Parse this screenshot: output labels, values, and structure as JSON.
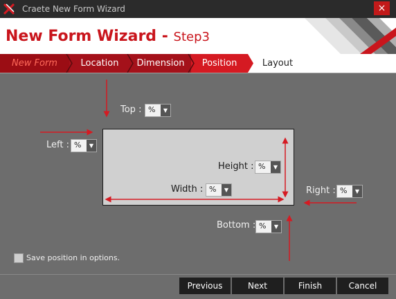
{
  "window": {
    "title": "Craete New Form Wizard",
    "close_glyph": "×"
  },
  "header": {
    "title": "New Form Wizard - ",
    "step": "Step3"
  },
  "tabs": [
    {
      "label": "New Form"
    },
    {
      "label": "Location"
    },
    {
      "label": "Dimension"
    },
    {
      "label": "Position"
    },
    {
      "label": "Layout"
    }
  ],
  "fields": {
    "top": {
      "label": "Top :",
      "value": "%"
    },
    "left": {
      "label": "Left :",
      "value": "%"
    },
    "height": {
      "label": "Height :",
      "value": "%"
    },
    "width": {
      "label": "Width :",
      "value": "%"
    },
    "right": {
      "label": "Right :",
      "value": "%"
    },
    "bottom": {
      "label": "Bottom :",
      "value": "%"
    }
  },
  "save_option": {
    "label": "Save position in options.",
    "checked": false
  },
  "buttons": {
    "previous": "Previous",
    "next": "Next",
    "finish": "Finish",
    "cancel": "Cancel"
  },
  "colors": {
    "accent_red": "#d51a22",
    "dark_red": "#a4111a",
    "panel_gray": "#6d6d6d",
    "title_bar": "#2b2b2b"
  }
}
